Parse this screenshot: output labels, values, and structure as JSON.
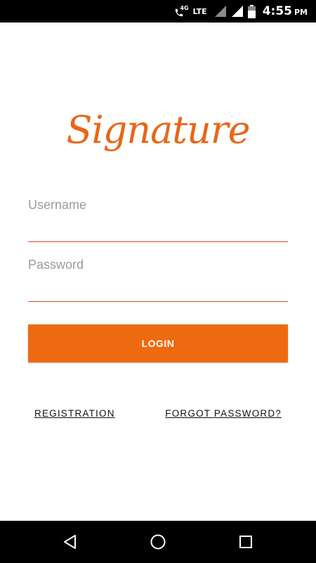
{
  "status_bar": {
    "network_badge": "4G",
    "network_type": "LTE",
    "time": "4:55",
    "ampm": "PM",
    "icons": [
      "call-4g-icon",
      "signal-icon",
      "signal-icon",
      "battery-icon"
    ]
  },
  "logo": {
    "text": "Signature"
  },
  "form": {
    "username_label": "Username",
    "username_value": "",
    "password_label": "Password",
    "password_value": ""
  },
  "login_button": {
    "label": "LOGIN"
  },
  "links": {
    "registration": "REGISTRATION",
    "forgot_password": "FORGOT PASSWORD?"
  },
  "nav_bar": {
    "icons": [
      "back-icon",
      "home-icon",
      "recents-icon"
    ]
  },
  "colors": {
    "accent": "#ee6a10",
    "logo": "#e8671a",
    "underline": "#d84d1c",
    "label": "#9b9b9b",
    "bars": "#000000"
  }
}
